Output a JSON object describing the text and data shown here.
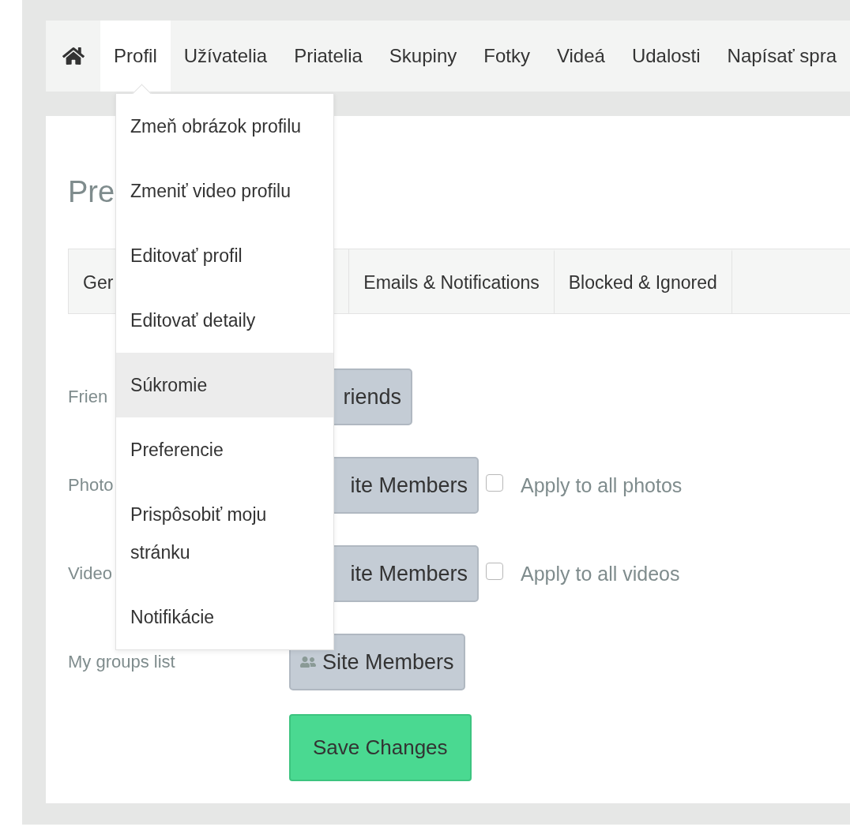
{
  "nav": {
    "items": [
      {
        "label": "Profil",
        "selected": true
      },
      {
        "label": "Užívatelia",
        "selected": false
      },
      {
        "label": "Priatelia",
        "selected": false
      },
      {
        "label": "Skupiny",
        "selected": false
      },
      {
        "label": "Fotky",
        "selected": false
      },
      {
        "label": "Videá",
        "selected": false
      },
      {
        "label": "Udalosti",
        "selected": false
      },
      {
        "label": "Napísať spra",
        "selected": false
      }
    ]
  },
  "menu": {
    "items": [
      {
        "label": "Zmeň obrázok profilu",
        "selected": false
      },
      {
        "label": "Zmeniť video profilu",
        "selected": false
      },
      {
        "label": "Editovať profil",
        "selected": false
      },
      {
        "label": "Editovať detaily",
        "selected": false
      },
      {
        "label": "Súkromie",
        "selected": true
      },
      {
        "label": "Preferencie",
        "selected": false
      },
      {
        "label": "Prispôsobiť moju stránku",
        "selected": false
      },
      {
        "label": "Notifikácie",
        "selected": false
      }
    ]
  },
  "heading": "Pre",
  "tabs": [
    {
      "label": "Ger",
      "selected": false
    },
    {
      "label": "Emails & Notifications",
      "selected": false
    },
    {
      "label": "Blocked & Ignored",
      "selected": false
    }
  ],
  "rows": [
    {
      "label": "Frien",
      "value": "riends",
      "icon": false
    },
    {
      "label": "Photo",
      "value": "ite Members",
      "icon": false,
      "checkbox": {
        "label": "Apply to all photos",
        "checked": false
      }
    },
    {
      "label": "Video",
      "value": "ite Members",
      "icon": false,
      "checkbox": {
        "label": "Apply to all videos",
        "checked": false
      }
    },
    {
      "label": "My groups list",
      "value": "Site Members",
      "icon": true
    }
  ],
  "save_button": "Save Changes"
}
